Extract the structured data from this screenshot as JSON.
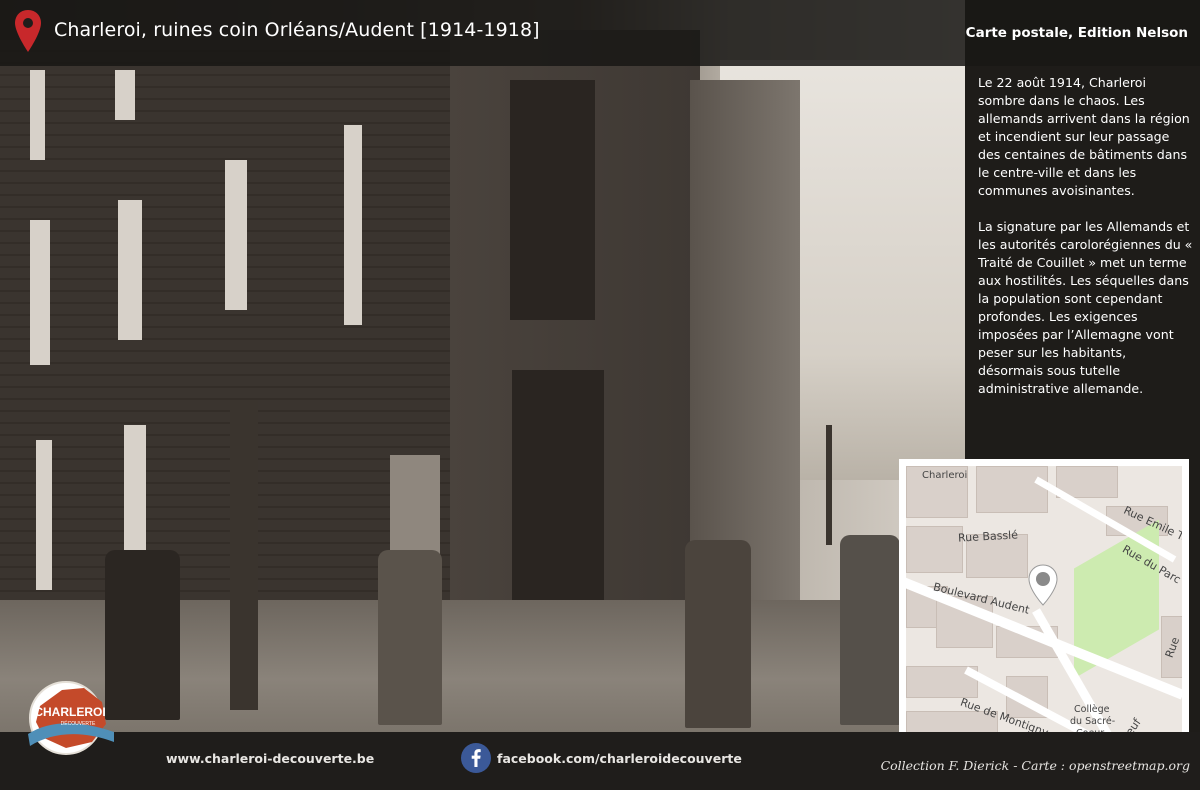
{
  "header": {
    "title": "Charleroi, ruines coin Orléans/Audent [1914-1918]",
    "source": "Carte postale, Edition Nelson",
    "pin_icon": "map-pin-icon",
    "pin_color": "#c8282b"
  },
  "description": {
    "paragraph_1": " Le 22 août 1914, Charleroi sombre dans le chaos. Les allemands arrivent dans la région et incendient sur leur passage des centaines de bâtiments dans le centre-ville et dans les communes avoisinantes.",
    "paragraph_2": "La signature par les Allemands et les autorités carolorégiennes du « Traité de Couillet » met un terme aux hostilités. Les séquelles dans la population sont cependant profondes. Les exigences imposées par l’Allemagne vont peser sur les habitants, désormais sous tutelle administrative allemande."
  },
  "map": {
    "labels": {
      "city": "Charleroi",
      "rue_bassle": "Rue Basslé",
      "rue_emile": "Rue Emile Tu",
      "rue_parc": "Rue du Parc",
      "boulevard": "Boulevard Audent",
      "montigny": "Rue de Montigny",
      "college": "Collège",
      "college_2": "du Sacré-",
      "college_3": "Coeur",
      "neuf": "Neuf",
      "rue_r": "Rue"
    },
    "pin_icon": "map-marker-icon"
  },
  "footer": {
    "website": "www.charleroi-decouverte.be",
    "facebook_icon": "facebook-icon",
    "facebook": "facebook.com/charleroidecouverte",
    "credit": "Collection F. Dierick - Carte : openstreetmap.org",
    "logo_line_1": "CHARLEROI",
    "logo_line_2": "DÉCOUVERTE"
  },
  "colors": {
    "logo_red": "#c44a2a",
    "logo_blue": "#4f8fb8",
    "facebook_blue": "#3b5998",
    "park_green": "#cdebb0"
  }
}
